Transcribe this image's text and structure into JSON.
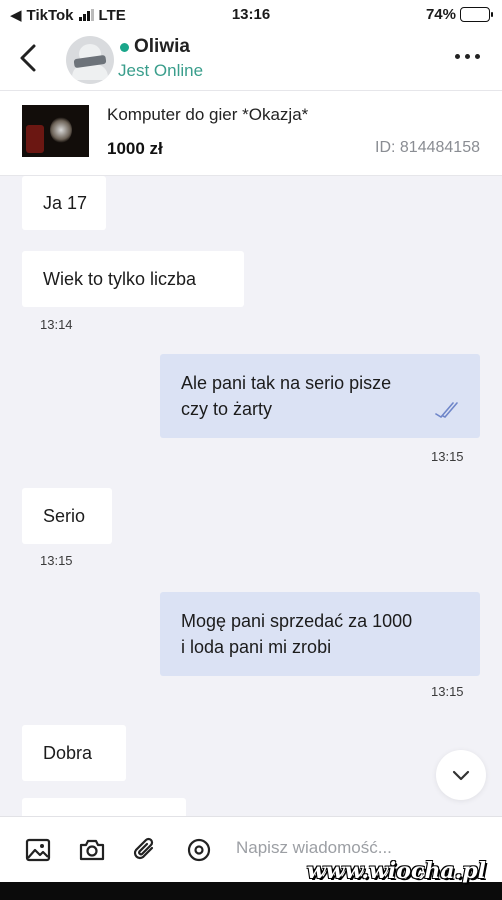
{
  "status_bar": {
    "back_app": "TikTok",
    "network": "LTE",
    "time": "13:16",
    "battery": "74%",
    "battery_level": 0.74
  },
  "header": {
    "name": "Oliwia",
    "status": "Jest Online",
    "colors": {
      "online": "#1aa68a"
    }
  },
  "listing": {
    "title": "Komputer do gier *Okazja*",
    "price": "1000 zł",
    "id": "ID: 814484158"
  },
  "messages": [
    {
      "direction": "in",
      "lines": [
        "Ja 17"
      ]
    },
    {
      "direction": "in",
      "lines": [
        "Wiek to tylko liczba"
      ],
      "time": "13:14"
    },
    {
      "direction": "out",
      "lines": [
        "Ale pani tak na serio pisze",
        "czy to żarty"
      ],
      "time": "13:15",
      "read": true
    },
    {
      "direction": "in",
      "lines": [
        "Serio"
      ],
      "time": "13:15"
    },
    {
      "direction": "out",
      "lines": [
        "Mogę pani sprzedać za 1000",
        "i loda pani mi zrobi"
      ],
      "time": "13:15"
    },
    {
      "direction": "in",
      "lines": [
        "Dobra"
      ]
    }
  ],
  "input": {
    "placeholder": "Napisz wiadomość..."
  },
  "icons": [
    "back-arrow-icon",
    "more-dots-icon",
    "gallery-icon",
    "camera-icon",
    "attachment-icon",
    "location-icon",
    "chevron-down-icon",
    "read-check-icon"
  ],
  "colors": {
    "outgoing_bubble": "#dbe2f4",
    "incoming_bubble": "#ffffff",
    "background": "#f2f2f7"
  },
  "watermark": "www.wiocha.pl"
}
